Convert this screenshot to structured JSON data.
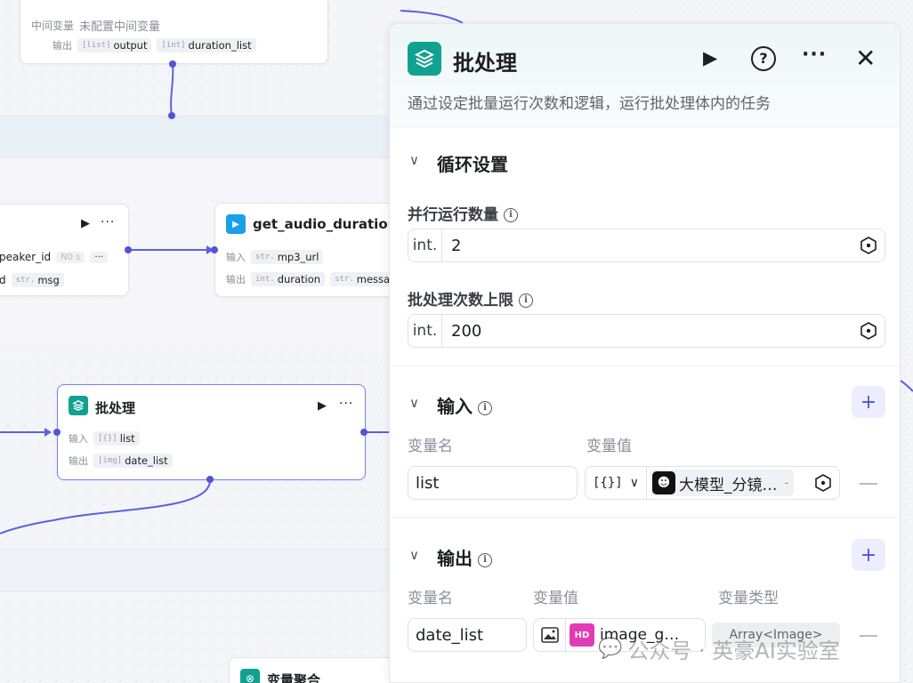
{
  "canvas": {
    "top_node": {
      "mid_var_label": "中间变量",
      "mid_var_value": "未配置中间变量",
      "output_label": "输出",
      "outputs": [
        {
          "type": "[list]",
          "name": "output"
        },
        {
          "type": "[int]",
          "name": "duration_list"
        }
      ]
    },
    "left_node": {
      "input_partial": "peaker_id",
      "input_partial_type": "N0 s",
      "output_partial": "d",
      "output_type": "str.",
      "output_name": "msg"
    },
    "audio_node": {
      "title": "get_audio_duration",
      "input_label": "输入",
      "inputs": [
        {
          "type": "str.",
          "name": "mp3_url"
        }
      ],
      "output_label": "输出",
      "outputs": [
        {
          "type": "int.",
          "name": "duration"
        },
        {
          "type": "str.",
          "name": "message"
        }
      ]
    },
    "batch_node": {
      "title": "批处理",
      "input_label": "输入",
      "input_type": "[{}]",
      "input_name": "list",
      "output_label": "输出",
      "output_type": "[img]",
      "output_name": "date_list"
    },
    "bottom_node": {
      "title": "变量聚合"
    }
  },
  "panel": {
    "title": "批处理",
    "description": "通过设定批量运行次数和逻辑，运行批处理体内的任务",
    "header_icons": [
      "play-icon",
      "help-icon",
      "more-icon",
      "close-icon"
    ],
    "loop": {
      "title": "循环设置",
      "parallel_label": "并行运行数量",
      "parallel_type": "int.",
      "parallel_value": "2",
      "limit_label": "批处理次数上限",
      "limit_type": "int.",
      "limit_value": "200"
    },
    "input": {
      "title": "输入",
      "col_name": "变量名",
      "col_value": "变量值",
      "row": {
        "name": "list",
        "type_icon": "[{}]",
        "value": "大模型_分镜…",
        "value_suffix": "-"
      }
    },
    "output": {
      "title": "输出",
      "col_name": "变量名",
      "col_value": "变量值",
      "col_type": "变量类型",
      "row": {
        "name": "date_list",
        "value": "image_g…",
        "type": "Array<Image>"
      }
    }
  },
  "watermark": {
    "text": "公众号 · 英豪AI实验室"
  },
  "colors": {
    "accent": "#4e55d8",
    "teal": "#10a191",
    "panel_bg": "#ffffff"
  }
}
